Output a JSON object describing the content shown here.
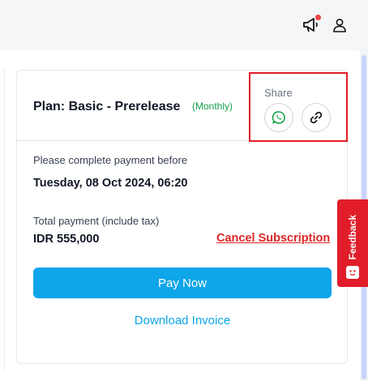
{
  "header": {
    "announcement_icon": "megaphone-icon",
    "user_icon": "user-icon",
    "notification_dot_color": "#ef4444"
  },
  "plan": {
    "title": "Plan: Basic - Prerelease",
    "period": "(Monthly)"
  },
  "share": {
    "label": "Share",
    "whatsapp_icon": "whatsapp-icon",
    "link_icon": "link-icon"
  },
  "payment": {
    "deadline_label": "Please complete payment before",
    "deadline_value": "Tuesday, 08 Oct 2024, 06:20",
    "total_label": "Total payment (include tax)",
    "total_value": "IDR 555,000",
    "cancel_label": "Cancel Subscription",
    "pay_label": "Pay Now",
    "download_label": "Download Invoice"
  },
  "feedback": {
    "label": "Feedback"
  },
  "colors": {
    "accent": "#0ea5e9",
    "danger": "#dc2626",
    "monthly_green": "#16a34a",
    "highlight_border": "#e11d2a"
  }
}
